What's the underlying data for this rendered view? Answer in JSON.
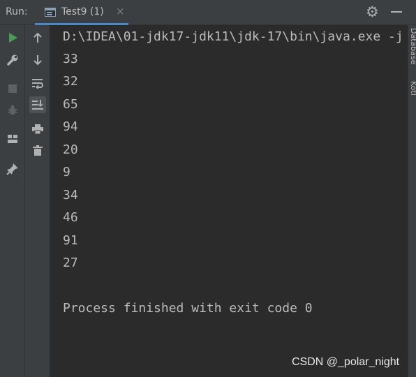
{
  "header": {
    "run_label": "Run:",
    "tab_title": "Test9 (1)",
    "tab_close": "×"
  },
  "right_strip": {
    "database_label": "Database",
    "kotlin_label": "Kotl"
  },
  "console": {
    "command": "D:\\IDEA\\01-jdk17-jdk11\\jdk-17\\bin\\java.exe -j",
    "outputs": [
      "33",
      "32",
      "65",
      "94",
      "20",
      "9",
      "34",
      "46",
      "91",
      "27"
    ],
    "exit_message": "Process finished with exit code 0"
  },
  "watermark": "CSDN @_polar_night",
  "colors": {
    "run_green": "#499c54",
    "accent_blue": "#4a88c7",
    "background": "#2b2b2b",
    "panel": "#3c3f41"
  },
  "icons": [
    "run-icon",
    "wrench-icon",
    "stop-icon",
    "debug-icon",
    "layout-icon",
    "pin-icon",
    "up-arrow-icon",
    "down-arrow-icon",
    "soft-wrap-icon",
    "scroll-to-end-icon",
    "print-icon",
    "trash-icon",
    "gear-icon",
    "minimize-icon"
  ]
}
